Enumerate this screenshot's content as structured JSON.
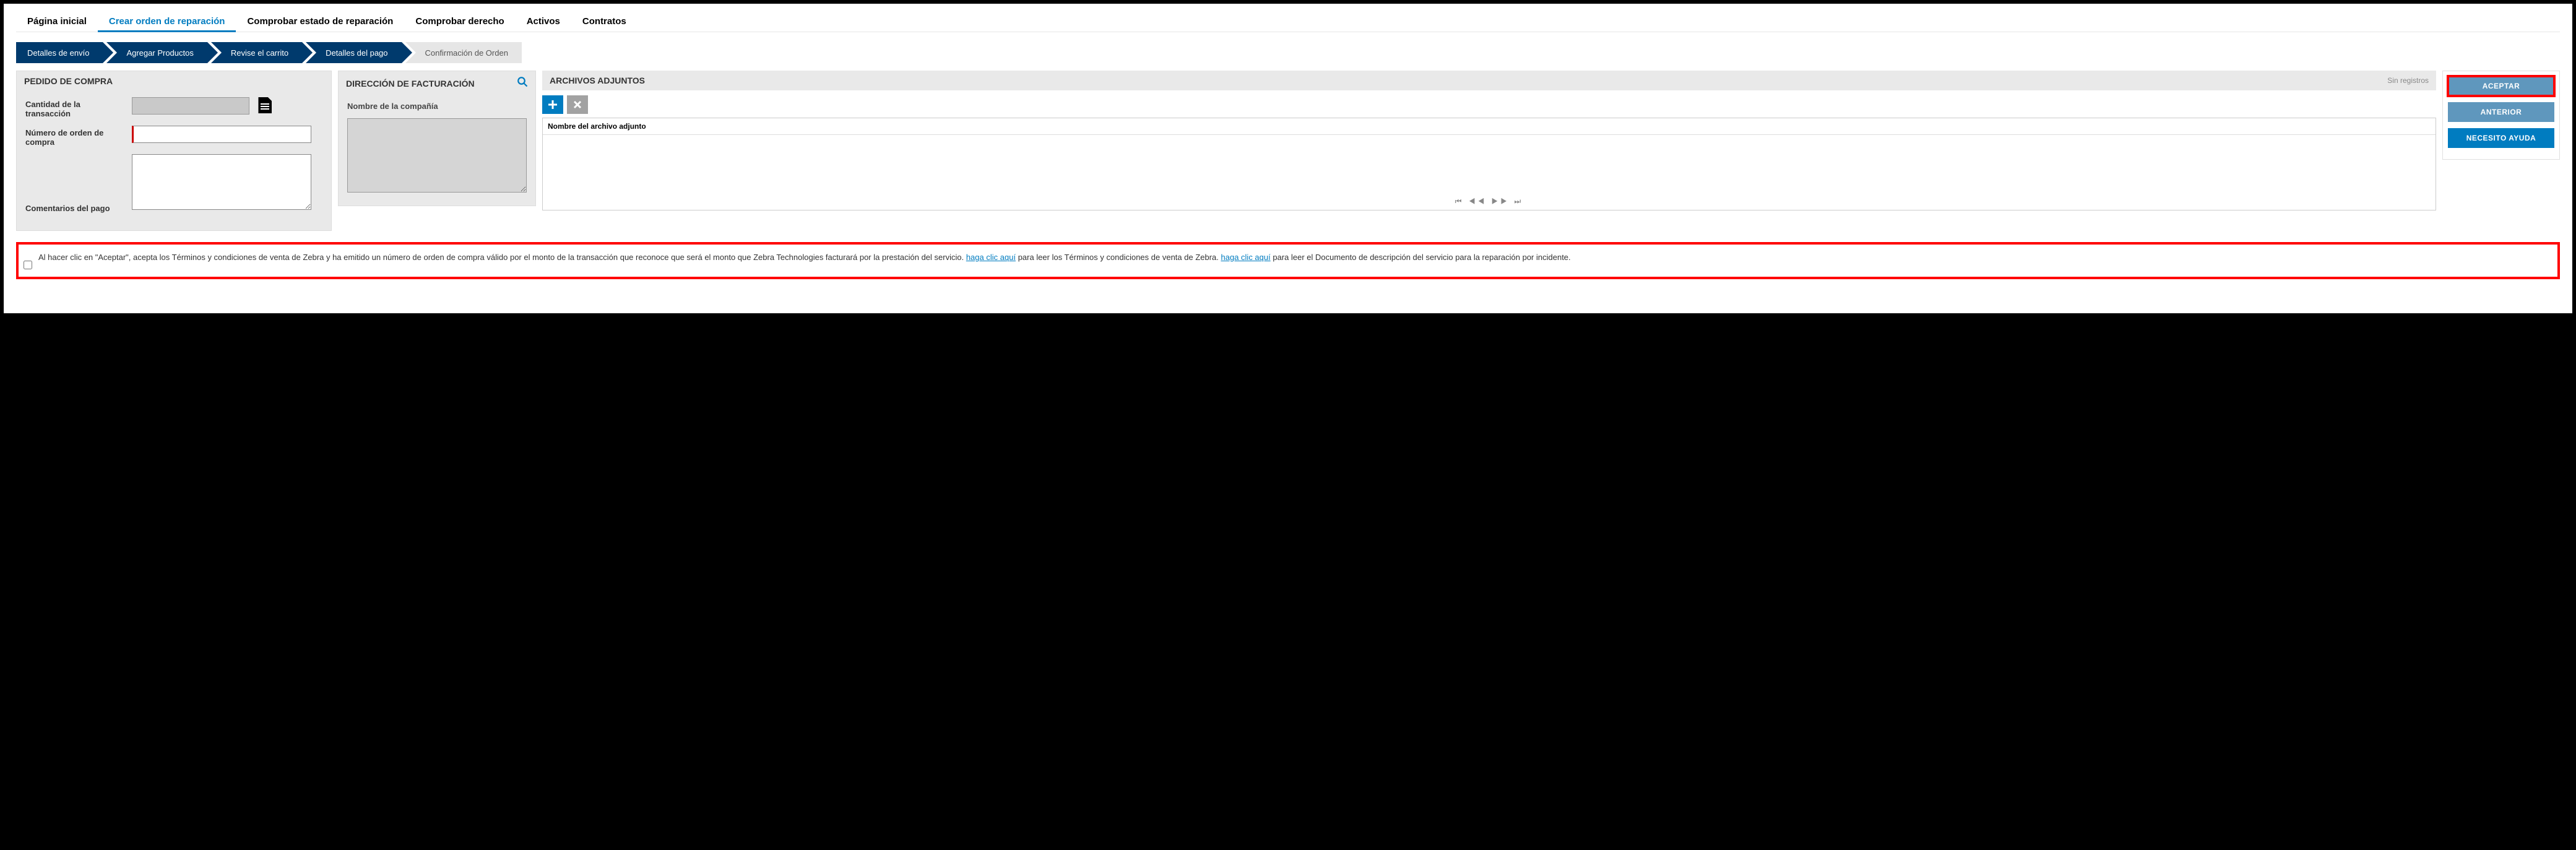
{
  "nav": {
    "home": "Página inicial",
    "create": "Crear orden de reparación",
    "status": "Comprobar estado de reparación",
    "entitle": "Comprobar derecho",
    "assets": "Activos",
    "contracts": "Contratos"
  },
  "wizard": {
    "s1": "Detalles de envío",
    "s2": "Agregar Productos",
    "s3": "Revise el carrito",
    "s4": "Detalles del pago",
    "s5": "Confirmación de Orden"
  },
  "po": {
    "title": "PEDIDO DE COMPRA",
    "amount_label": "Cantidad de la transacción",
    "ponum_label": "Número de orden de compra",
    "comments_label": "Comentarios del pago"
  },
  "bill": {
    "title": "DIRECCIÓN DE FACTURACIÓN",
    "company_label": "Nombre de la compañía"
  },
  "att": {
    "title": "ARCHIVOS ADJUNTOS",
    "norecords": "Sin registros",
    "colname": "Nombre del archivo adjunto"
  },
  "actions": {
    "accept": "ACEPTAR",
    "prev": "ANTERIOR",
    "help": "NECESITO AYUDA"
  },
  "terms": {
    "t1": "Al hacer clic en \"Aceptar\", acepta los Términos y condiciones de venta de Zebra y ha emitido un número de orden de compra válido por el monto de la transacción que reconoce que será el monto que Zebra Technologies facturará por la prestación del servicio. ",
    "link1": " haga clic aquí",
    "t2": " para leer los Términos y condiciones de venta de Zebra. ",
    "link2": " haga clic aquí",
    "t3": " para leer el Documento de descripción del servicio para la reparación por incidente."
  }
}
